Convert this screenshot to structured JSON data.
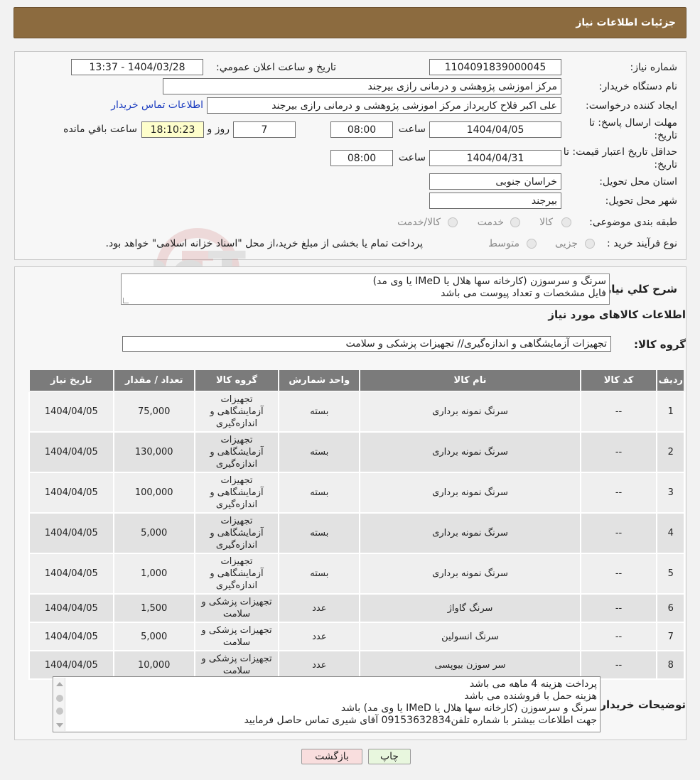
{
  "header": {
    "title": "جزئیات اطلاعات نیاز"
  },
  "form": {
    "need_number_label": "شماره نیاز:",
    "need_number": "1104091839000045",
    "announce_label": "تاریخ و ساعت اعلان عمومي:",
    "announce_value": "1404/03/28 - 13:37",
    "buyer_org_label": "نام دستگاه خريدار:",
    "buyer_org": "مرکز اموزشی پژوهشی و درمانی رازی بیرجند",
    "creator_label": "ايجاد کننده درخواست:",
    "creator": "علی اکبر فلاح کارپرداز مرکز اموزشی پژوهشی و درمانی رازی بیرجند",
    "contact_link": "اطلاعات تماس خريدار",
    "deadline_label_1": "مهلت ارسال پاسخ: تا",
    "deadline_label_2": "تاريخ:",
    "deadline_date": "1404/04/05",
    "time_label": "ساعت",
    "deadline_time": "08:00",
    "days_value": "7",
    "days_label": "روز و",
    "remaining_time": "18:10:23",
    "remaining_label": "ساعت باقي مانده",
    "validity_label_1": "حداقل تاريخ اعتبار قيمت: تا",
    "validity_label_2": "تاريخ:",
    "validity_date": "1404/04/31",
    "validity_time": "08:00",
    "province_label": "استان محل تحويل:",
    "province": "خراسان جنوبی",
    "city_label": "شهر محل تحويل:",
    "city": "بیرجند",
    "category_label": "طبقه بندی موضوعی:",
    "category_options": [
      "کالا",
      "خدمت",
      "کالا/خدمت"
    ],
    "process_label": "نوع فرآیند خرید :",
    "process_options": [
      "جزیی",
      "متوسط"
    ],
    "process_note": "پرداخت تمام يا بخشی از مبلغ خريد،از محل \"اسناد خزانه اسلامی\" خواهد بود."
  },
  "details": {
    "summary_label": "شرح کلي نياز:",
    "summary_lines": [
      "سرنگ و سرسوزن (کارخانه سها هلال یا IMeD یا وی مد)",
      "فایل مشخصات و تعداد پیوست می باشد"
    ],
    "goods_info_title": "اطلاعات کالاهای مورد نياز",
    "goods_group_label": "گروه کالا:",
    "goods_group": "تجهیزات آزمایشگاهی و اندازه‌گیری// تجهیزات پزشکی و سلامت"
  },
  "table": {
    "headers": [
      "رديف",
      "کد کالا",
      "نام کالا",
      "واحد شمارش",
      "گروه کالا",
      "تعداد / مقدار",
      "تاريخ نياز"
    ],
    "rows": [
      {
        "row": "1",
        "code": "--",
        "name": "سرنگ نمونه برداری",
        "unit": "بسته",
        "group": "تجهیزات آزمایشگاهی و اندازه‌گیری",
        "qty": "75,000",
        "date": "1404/04/05"
      },
      {
        "row": "2",
        "code": "--",
        "name": "سرنگ نمونه برداری",
        "unit": "بسته",
        "group": "تجهیزات آزمایشگاهی و اندازه‌گیری",
        "qty": "130,000",
        "date": "1404/04/05"
      },
      {
        "row": "3",
        "code": "--",
        "name": "سرنگ نمونه برداری",
        "unit": "بسته",
        "group": "تجهیزات آزمایشگاهی و اندازه‌گیری",
        "qty": "100,000",
        "date": "1404/04/05"
      },
      {
        "row": "4",
        "code": "--",
        "name": "سرنگ نمونه برداری",
        "unit": "بسته",
        "group": "تجهیزات آزمایشگاهی و اندازه‌گیری",
        "qty": "5,000",
        "date": "1404/04/05"
      },
      {
        "row": "5",
        "code": "--",
        "name": "سرنگ نمونه برداری",
        "unit": "بسته",
        "group": "تجهیزات آزمایشگاهی و اندازه‌گیری",
        "qty": "1,000",
        "date": "1404/04/05"
      },
      {
        "row": "6",
        "code": "--",
        "name": "سرنگ گاواژ",
        "unit": "عدد",
        "group": "تجهیزات پزشکی و سلامت",
        "qty": "1,500",
        "date": "1404/04/05"
      },
      {
        "row": "7",
        "code": "--",
        "name": "سرنگ انسولین",
        "unit": "عدد",
        "group": "تجهیزات پزشکی و سلامت",
        "qty": "5,000",
        "date": "1404/04/05"
      },
      {
        "row": "8",
        "code": "--",
        "name": "سر سوزن بیوپسی",
        "unit": "عدد",
        "group": "تجهیزات پزشکی و سلامت",
        "qty": "10,000",
        "date": "1404/04/05"
      }
    ]
  },
  "buyer_notes": {
    "label": "توضيحات خريدار:",
    "lines": [
      "پرداخت هزینه 4 ماهه می باشد",
      "هزینه حمل با فروشنده می باشد",
      "سرنگ و سرسوزن (کارخانه سها هلال یا IMeD یا وی مد) باشد",
      "جهت اطلاعات بیشتر با شماره تلفن09153632834 آقای شیری تماس حاصل فرمایید"
    ]
  },
  "buttons": {
    "print": "چاپ",
    "back": "بازگشت"
  },
  "watermark_text": "AriaTender.neT",
  "colors": {
    "header_bg": "#8c6b3f",
    "table_header_bg": "#7b7b7b",
    "back_button_bg": "#f9dede",
    "print_button_bg": "#e8f7de"
  }
}
